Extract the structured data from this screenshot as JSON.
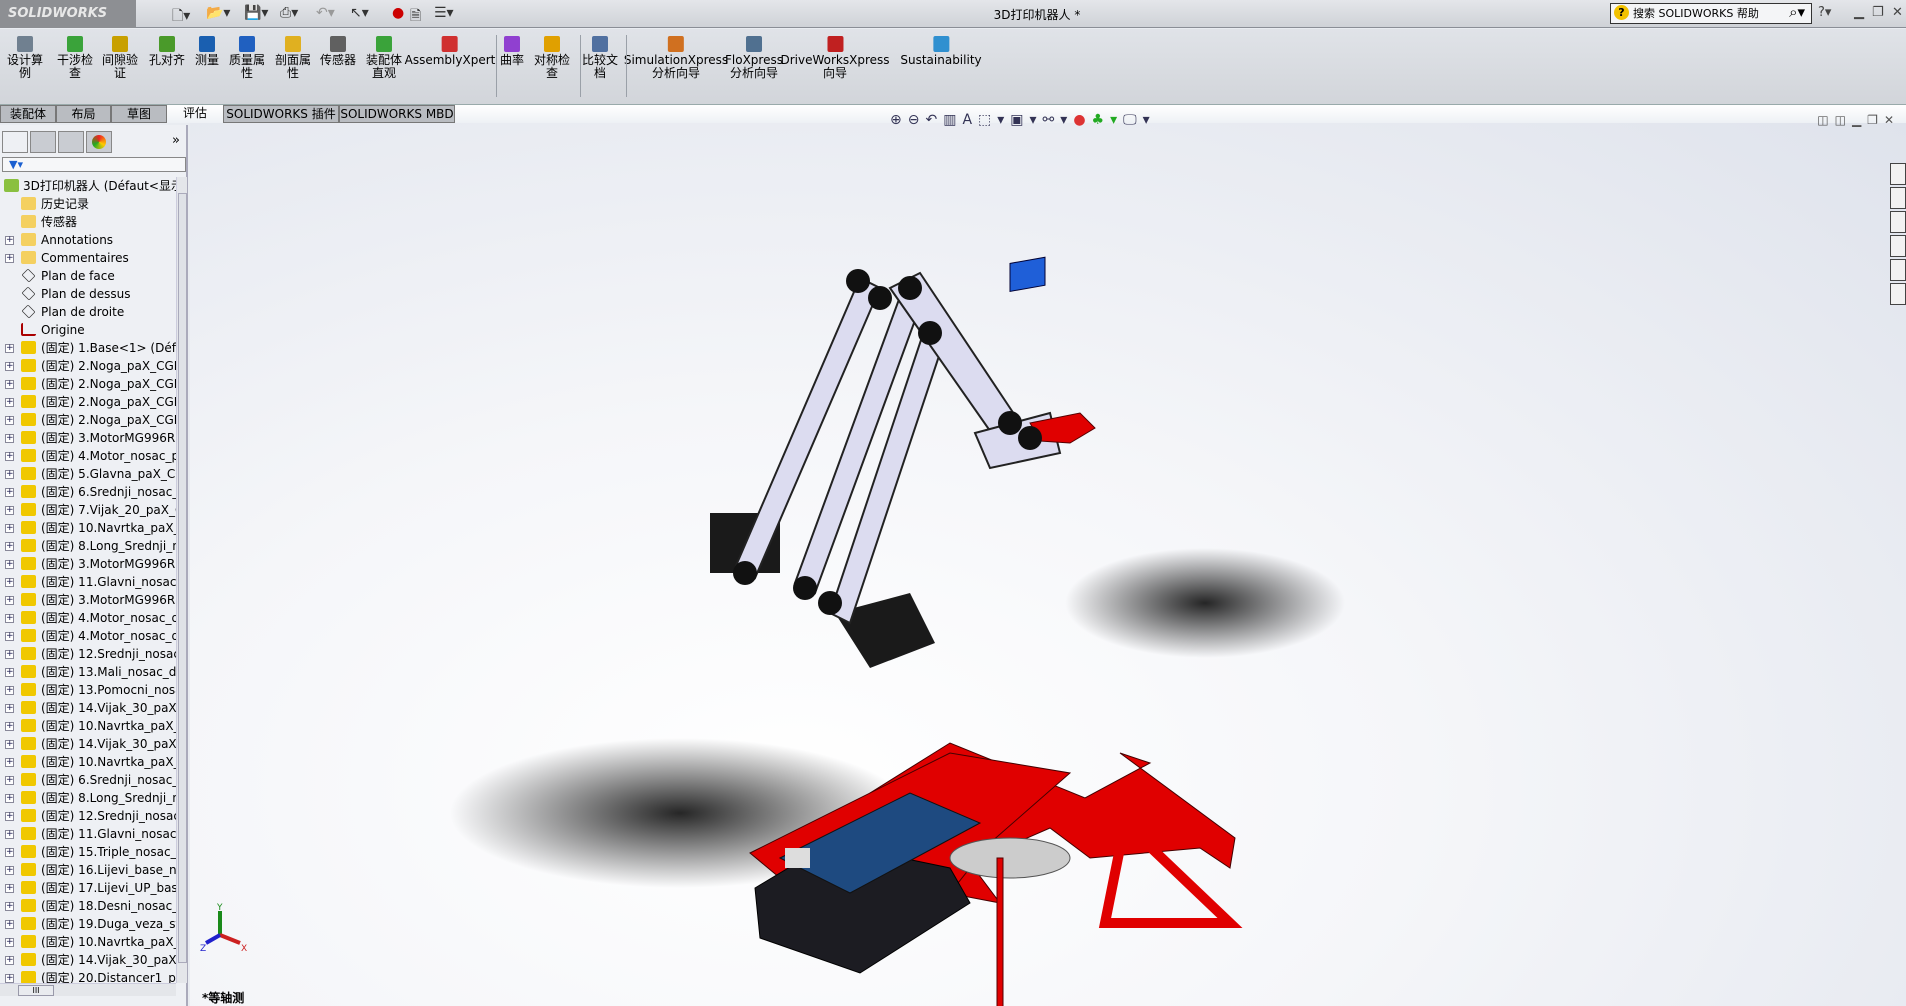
{
  "app": {
    "logo": "SOLIDWORKS",
    "title": "3D打印机器人 *"
  },
  "search": {
    "placeholder": "搜索 SOLIDWORKS 帮助"
  },
  "ribbon": [
    {
      "label": "设计算\n例",
      "icon": "design-study-icon",
      "color": "#708090"
    },
    {
      "label": "干涉检\n查",
      "icon": "interference-check-icon",
      "color": "#3aa33a"
    },
    {
      "label": "间隙验\n证",
      "icon": "clearance-verification-icon",
      "color": "#c8a000"
    },
    {
      "label": "孔对齐",
      "icon": "hole-alignment-icon",
      "color": "#4a9a2a"
    },
    {
      "label": "测量",
      "icon": "measure-icon",
      "color": "#1a5fb0"
    },
    {
      "label": "质量属\n性",
      "icon": "mass-properties-icon",
      "color": "#2060c0"
    },
    {
      "label": "剖面属\n性",
      "icon": "section-properties-icon",
      "color": "#e0b020"
    },
    {
      "label": "传感器",
      "icon": "sensor-icon",
      "color": "#606060"
    },
    {
      "label": "装配体\n直观",
      "icon": "assemblyxpert-visual-icon",
      "color": "#3aa33a"
    },
    {
      "label": "AssemblyXpert",
      "icon": "assemblyxpert-icon",
      "color": "#d03030"
    },
    {
      "label": "曲率",
      "icon": "curvature-icon",
      "color": "#9040d0"
    },
    {
      "label": "对称检\n查",
      "icon": "symmetry-check-icon",
      "color": "#e0a000"
    },
    {
      "label": "比较文\n档",
      "icon": "compare-documents-icon",
      "color": "#5070a0"
    },
    {
      "label": "SimulationXpress\n分析向导",
      "icon": "simulationxpress-icon",
      "color": "#d07020"
    },
    {
      "label": "FloXpress\n分析向导",
      "icon": "floxpress-icon",
      "color": "#507090"
    },
    {
      "label": "DriveWorksXpress\n向导",
      "icon": "driveworksxpress-icon",
      "color": "#c02020"
    },
    {
      "label": "Sustainability",
      "icon": "sustainability-icon",
      "color": "#3090d0"
    }
  ],
  "tabs": [
    "装配体",
    "布局",
    "草图",
    "评估",
    "SOLIDWORKS 插件",
    "SOLIDWORKS MBD"
  ],
  "active_tab": "评估",
  "tree": {
    "root": "3D打印机器人  (Défaut<显示",
    "items": [
      {
        "label": "历史记录",
        "icon": "history-folder-icon",
        "exp": false
      },
      {
        "label": "传感器",
        "icon": "sensors-folder-icon",
        "exp": false
      },
      {
        "label": "Annotations",
        "icon": "annotations-icon",
        "exp": true
      },
      {
        "label": "Commentaires",
        "icon": "comments-folder-icon",
        "exp": true
      },
      {
        "label": "Plan de face",
        "icon": "plane-icon",
        "exp": false
      },
      {
        "label": "Plan de dessus",
        "icon": "plane-icon",
        "exp": false
      },
      {
        "label": "Plan de droite",
        "icon": "plane-icon",
        "exp": false
      },
      {
        "label": "Origine",
        "icon": "origin-icon",
        "exp": false
      },
      {
        "label": "(固定) 1.Base<1> (Défa",
        "icon": "part-icon",
        "exp": true
      },
      {
        "label": "(固定) 2.Noga_paX_CGI",
        "icon": "part-icon",
        "exp": true
      },
      {
        "label": "(固定) 2.Noga_paX_CGI",
        "icon": "part-icon",
        "exp": true
      },
      {
        "label": "(固定) 2.Noga_paX_CGI",
        "icon": "part-icon",
        "exp": true
      },
      {
        "label": "(固定) 2.Noga_paX_CGI",
        "icon": "part-icon",
        "exp": true
      },
      {
        "label": "(固定) 3.MotorMG996R",
        "icon": "part-icon",
        "exp": true
      },
      {
        "label": "(固定) 4.Motor_nosac_p",
        "icon": "part-icon",
        "exp": true
      },
      {
        "label": "(固定) 5.Glavna_paX_CG",
        "icon": "part-icon",
        "exp": true
      },
      {
        "label": "(固定) 6.Srednji_nosac_",
        "icon": "part-icon",
        "exp": true
      },
      {
        "label": "(固定) 7.Vijak_20_paX_C",
        "icon": "part-icon",
        "exp": true
      },
      {
        "label": "(固定) 10.Navrtka_paX_",
        "icon": "part-icon",
        "exp": true
      },
      {
        "label": "(固定) 8.Long_Srednji_n",
        "icon": "part-icon",
        "exp": true
      },
      {
        "label": "(固定) 3.MotorMG996R",
        "icon": "part-icon",
        "exp": true
      },
      {
        "label": "(固定) 11.Glavni_nosac_",
        "icon": "part-icon",
        "exp": true
      },
      {
        "label": "(固定) 3.MotorMG996R",
        "icon": "part-icon",
        "exp": true
      },
      {
        "label": "(固定) 4.Motor_nosac_d",
        "icon": "part-icon",
        "exp": true
      },
      {
        "label": "(固定) 4.Motor_nosac_d",
        "icon": "part-icon",
        "exp": true
      },
      {
        "label": "(固定) 12.Srednji_nosac",
        "icon": "part-icon",
        "exp": true
      },
      {
        "label": "(固定) 13.Mali_nosac_d",
        "icon": "part-icon",
        "exp": true
      },
      {
        "label": "(固定) 13.Pomocni_nosa",
        "icon": "part-icon",
        "exp": true
      },
      {
        "label": "(固定) 14.Vijak_30_paX_",
        "icon": "part-icon",
        "exp": true
      },
      {
        "label": "(固定) 10.Navrtka_paX_",
        "icon": "part-icon",
        "exp": true
      },
      {
        "label": "(固定) 14.Vijak_30_paX_",
        "icon": "part-icon",
        "exp": true
      },
      {
        "label": "(固定) 10.Navrtka_paX_",
        "icon": "part-icon",
        "exp": true
      },
      {
        "label": "(固定) 6.Srednji_nosac_",
        "icon": "part-icon",
        "exp": true
      },
      {
        "label": "(固定) 8.Long_Srednji_n",
        "icon": "part-icon",
        "exp": true
      },
      {
        "label": "(固定) 12.Srednji_nosac",
        "icon": "part-icon",
        "exp": true
      },
      {
        "label": "(固定) 11.Glavni_nosac_",
        "icon": "part-icon",
        "exp": true
      },
      {
        "label": "(固定) 15.Triple_nosac_",
        "icon": "part-icon",
        "exp": true
      },
      {
        "label": "(固定) 16.Lijevi_base_no",
        "icon": "part-icon",
        "exp": true
      },
      {
        "label": "(固定) 17.Lijevi_UP_base",
        "icon": "part-icon",
        "exp": true
      },
      {
        "label": "(固定) 18.Desni_nosac_s",
        "icon": "part-icon",
        "exp": true
      },
      {
        "label": "(固定) 19.Duga_veza_sti",
        "icon": "part-icon",
        "exp": true
      },
      {
        "label": "(固定) 10.Navrtka_paX_",
        "icon": "part-icon",
        "exp": true
      },
      {
        "label": "(固定) 14.Vijak_30_paX_",
        "icon": "part-icon",
        "exp": true
      },
      {
        "label": "(固定) 20.Distancer1_pa",
        "icon": "part-icon",
        "exp": true
      }
    ]
  },
  "viewport": {
    "view_name": "*等轴测",
    "triad": {
      "x": "X",
      "y": "Y",
      "z": "Z"
    }
  },
  "colors": {
    "accent_red": "#e00000",
    "arm_gray": "#dcdcf0",
    "servo_black": "#1a1a1a",
    "board_blue": "#1e4a80",
    "block_blue": "#1f5fd8"
  }
}
